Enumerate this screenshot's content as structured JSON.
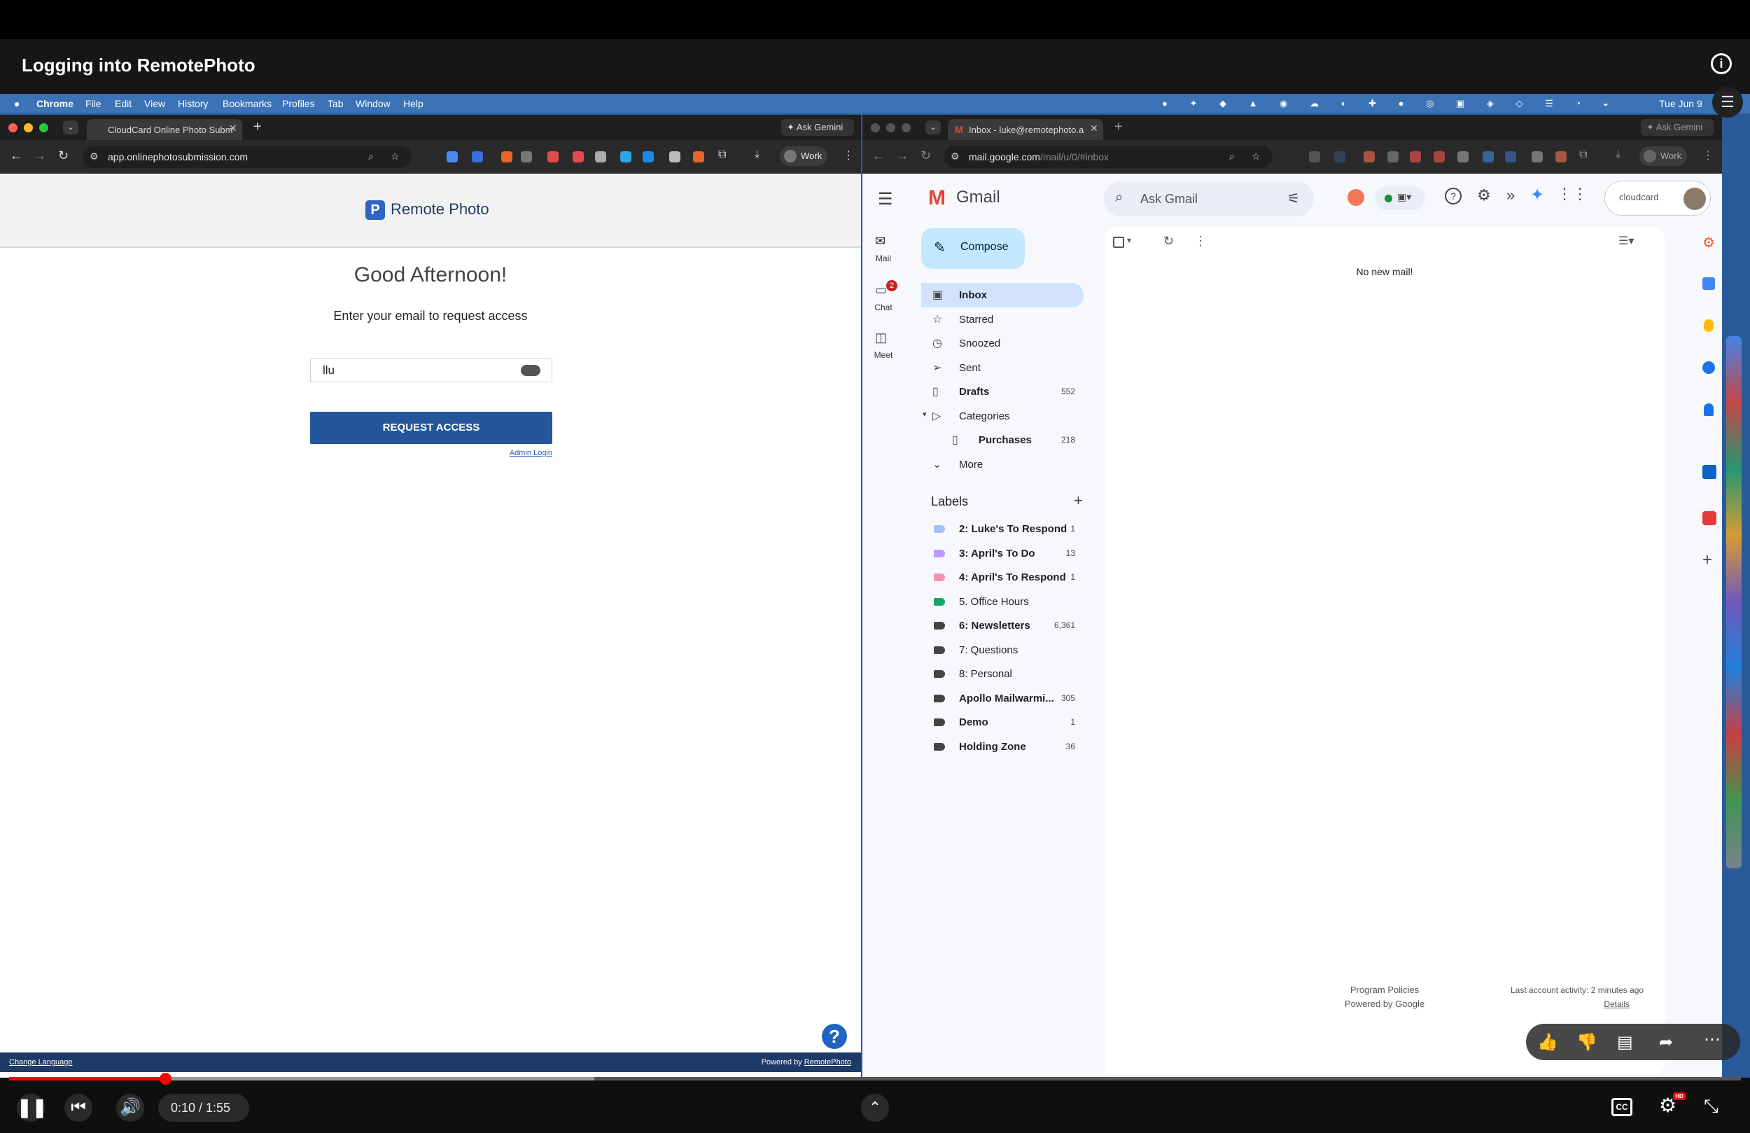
{
  "video": {
    "title": "Logging  into RemotePhoto",
    "time": "0:10 / 1:55",
    "progress": 0.09
  },
  "menubar": {
    "app": "Chrome",
    "items": [
      "File",
      "Edit",
      "View",
      "History",
      "Bookmarks",
      "Profiles",
      "Tab",
      "Window",
      "Help"
    ],
    "clock": "Tue Jun 9"
  },
  "left_browser": {
    "tab_title": "CloudCard Online Photo Subm",
    "ask_gemini": "Ask Gemini",
    "url": "app.onlinephotosubmission.com",
    "profile": "Work"
  },
  "remotephoto": {
    "brand": "Remote Photo",
    "greeting": "Good Afternoon!",
    "subtitle": "Enter your email to request access",
    "email_value": "llu",
    "request_button": "REQUEST ACCESS",
    "admin_link": "Admin Login",
    "footer_left": "Change Language",
    "footer_right_prefix": "Powered by ",
    "footer_right_link": "RemotePhoto"
  },
  "right_browser": {
    "tab_title": "Inbox - luke@remotephoto.a",
    "ask_gemini": "Ask Gemini",
    "url_main": "mail.google.com",
    "url_rest": "/mail/u/0/#inbox",
    "profile": "Work"
  },
  "gmail": {
    "brand": "Gmail",
    "search_placeholder": "Ask Gmail",
    "account_chip": "cloudcard",
    "compose": "Compose",
    "rail": [
      {
        "label": "Mail"
      },
      {
        "label": "Chat",
        "badge": "2"
      },
      {
        "label": "Meet"
      }
    ],
    "nav": [
      {
        "label": "Inbox",
        "count": "",
        "bold": true,
        "active": true
      },
      {
        "label": "Starred",
        "count": "",
        "bold": false
      },
      {
        "label": "Snoozed",
        "count": "",
        "bold": false
      },
      {
        "label": "Sent",
        "count": "",
        "bold": false
      },
      {
        "label": "Drafts",
        "count": "552",
        "bold": true
      },
      {
        "label": "Categories",
        "count": "",
        "bold": false
      },
      {
        "label": "Purchases",
        "count": "218",
        "bold": true
      },
      {
        "label": "More",
        "count": "",
        "bold": false
      }
    ],
    "labels_header": "Labels",
    "labels": [
      {
        "label": "2: Luke's To Respond",
        "count": "1",
        "color": "#a4c2f4",
        "bold": true
      },
      {
        "label": "3: April's To Do",
        "count": "13",
        "color": "#b99aff",
        "bold": true
      },
      {
        "label": "4: April's To Respond",
        "count": "1",
        "color": "#f691b2",
        "bold": true
      },
      {
        "label": "5. Office Hours",
        "count": "",
        "color": "#16a766",
        "bold": false
      },
      {
        "label": "6: Newsletters",
        "count": "6,361",
        "color": "#444444",
        "bold": true
      },
      {
        "label": "7: Questions",
        "count": "",
        "color": "#444444",
        "bold": false
      },
      {
        "label": "8: Personal",
        "count": "",
        "color": "#444444",
        "bold": false
      },
      {
        "label": "Apollo Mailwarmi...",
        "count": "305",
        "color": "#444444",
        "bold": true
      },
      {
        "label": "Demo",
        "count": "1",
        "color": "#444444",
        "bold": true
      },
      {
        "label": "Holding Zone",
        "count": "36",
        "color": "#444444",
        "bold": true
      }
    ],
    "empty_message": "No new mail!",
    "footer_line1": "Program Policies",
    "footer_line2": "Powered by Google",
    "last_activity": "Last account activity: 2 minutes ago",
    "details": "Details"
  }
}
